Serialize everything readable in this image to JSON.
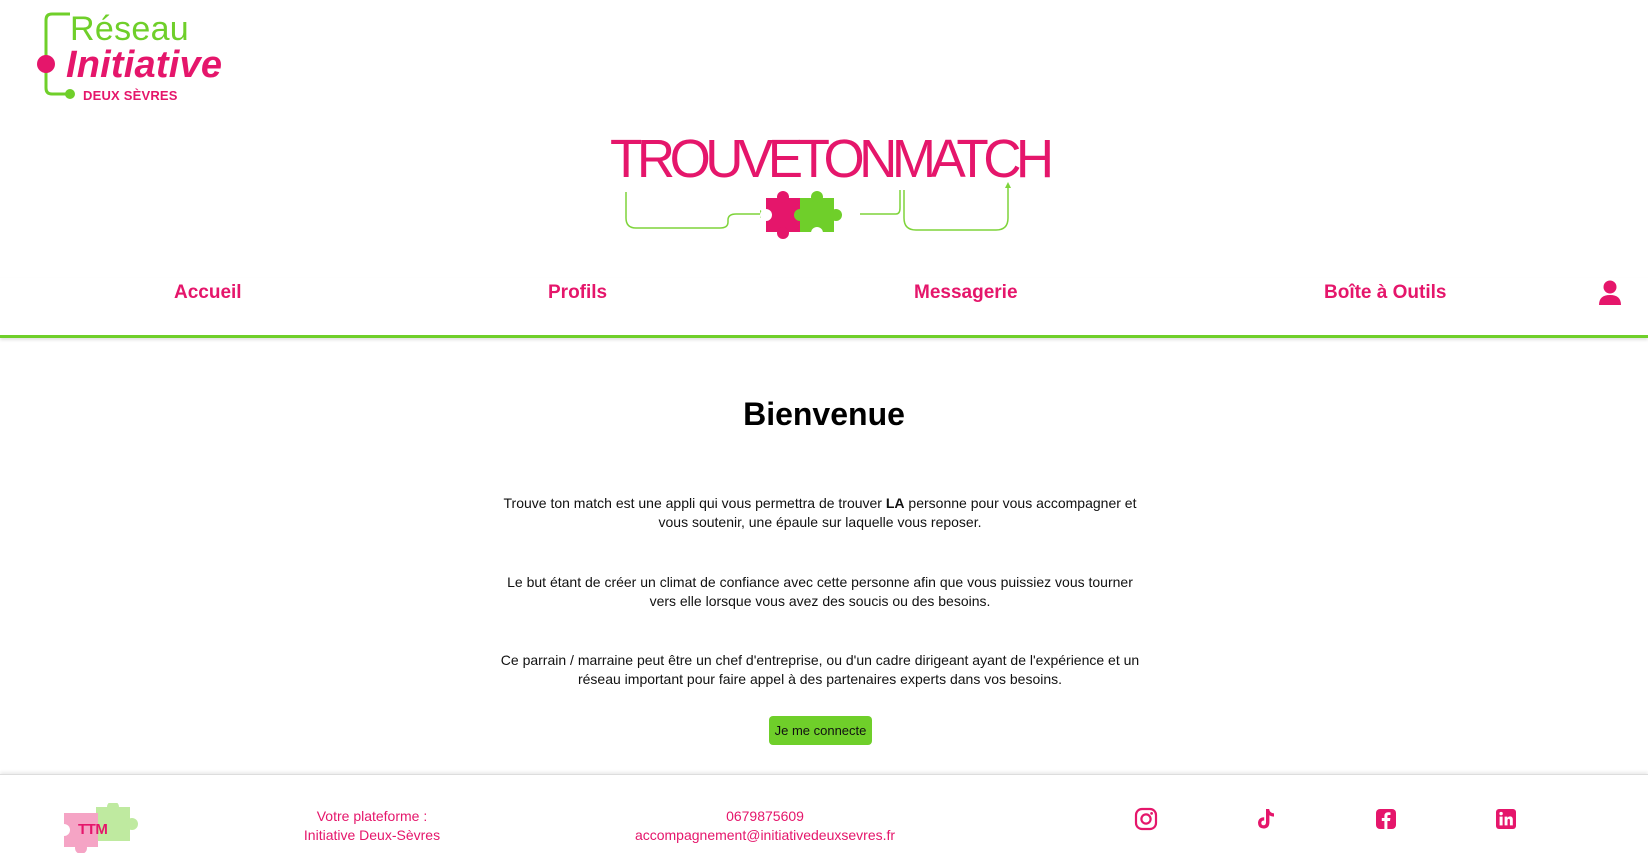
{
  "header": {
    "brand_logo": {
      "line1": "Réseau",
      "line2": "Initiative",
      "line3": "DEUX SÈVRES"
    },
    "app_logo": {
      "text": "TROUVETONMATCH"
    }
  },
  "nav": {
    "items": [
      {
        "label": "Accueil"
      },
      {
        "label": "Profils"
      },
      {
        "label": "Messagerie"
      },
      {
        "label": "Boîte à Outils"
      }
    ],
    "account_icon": "user-icon"
  },
  "main": {
    "title": "Bienvenue",
    "paragraph1_before": "Trouve ton match est une appli qui vous permettra de trouver ",
    "paragraph1_bold": "LA",
    "paragraph1_after": " personne pour vous accompagner et vous soutenir, une épaule sur laquelle vous reposer.",
    "paragraph2": "Le but étant de créer un climat de confiance avec cette personne afin que vous puissiez vous tourner vers elle lorsque vous avez des soucis ou des besoins.",
    "paragraph3": "Ce parrain / marraine peut être un chef d'entreprise, ou d'un cadre dirigeant ayant de l'expérience et un réseau important pour faire appel à des partenaires experts dans vos besoins.",
    "connect_button": "Je me connecte"
  },
  "footer": {
    "mini_logo": "TTM",
    "platform_line1": "Votre plateforme :",
    "platform_line2": "Initiative Deux-Sèvres",
    "phone": "0679875609",
    "email": "accompagnement@initiativedeuxsevres.fr",
    "social_icons": [
      "instagram-icon",
      "tiktok-icon",
      "facebook-icon",
      "linkedin-icon"
    ]
  },
  "colors": {
    "primary": "#e5166b",
    "accent": "#6fcf2a",
    "background": "#ffffff",
    "text": "#111111"
  }
}
